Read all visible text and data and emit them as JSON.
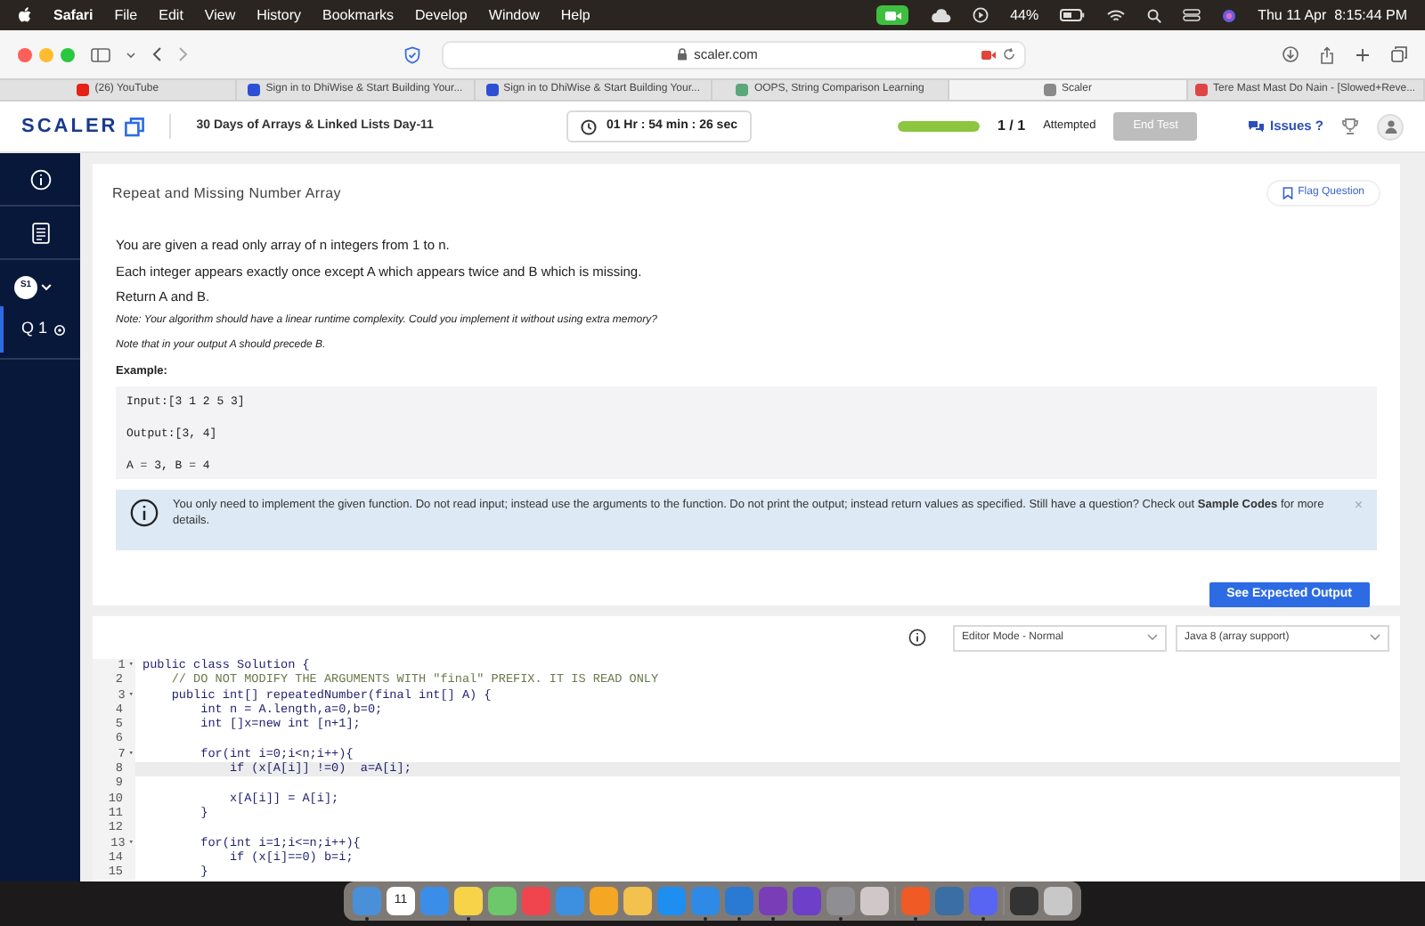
{
  "menubar": {
    "app": "Safari",
    "menus": [
      "File",
      "Edit",
      "View",
      "History",
      "Bookmarks",
      "Develop",
      "Window",
      "Help"
    ],
    "battery": "44%",
    "clock": "Thu 11 Apr  8:15:44 PM"
  },
  "browser": {
    "address": "scaler.com",
    "tabs": [
      {
        "title": "(26) YouTube",
        "selected": false,
        "color": "#e62117"
      },
      {
        "title": "Sign in to DhiWise & Start Building Your...",
        "selected": false,
        "color": "#2d4fd6"
      },
      {
        "title": "Sign in to DhiWise & Start Building Your...",
        "selected": false,
        "color": "#2d4fd6"
      },
      {
        "title": "OOPS, String Comparison Learning",
        "selected": false,
        "color": "#5aa87a"
      },
      {
        "title": "Scaler",
        "selected": true,
        "color": "#8a8a8a"
      },
      {
        "title": "Tere Mast Mast Do Nain - [Slowed+Reve...",
        "selected": false,
        "color": "#e04545"
      }
    ]
  },
  "header": {
    "logo": "SCALER",
    "title": "30 Days of Arrays & Linked Lists Day-11",
    "timer": "01 Hr : 54 min : 26 sec",
    "progress": {
      "level": 1.0
    },
    "count": "1 / 1",
    "count_label": "Attempted",
    "end_test": {
      "label": "End Test",
      "disabled": true
    },
    "issues": "Issues ?"
  },
  "sidebar": {
    "section": "S1",
    "questions": [
      {
        "label": "Q 1",
        "selected": true
      }
    ]
  },
  "problem": {
    "title": "Repeat and Missing Number Array",
    "flag": "Flag Question",
    "paragraphs": [
      "You are given a read only array of n integers from 1 to n.",
      "Each integer appears exactly once except A which appears twice and B which is missing.",
      "Return A and B."
    ],
    "notes": [
      "Note: Your algorithm should have a linear runtime complexity. Could you implement it without using extra memory?",
      "Note that in your output A should precede B."
    ],
    "example_label": "Example:",
    "example_lines": [
      "Input:[3 1 2 5 3]",
      "Output:[3, 4]",
      "A = 3, B = 4"
    ],
    "info": "You only need to implement the given function. Do not read input; instead use the arguments to the function. Do not print the output; instead return values as specified. Still have a question? Check out **Sample Codes** for more details.",
    "close": "×",
    "button": "See Expected Output"
  },
  "editor": {
    "mode": "Editor Mode - Normal",
    "language": "Java 8 (array support)",
    "lines": [
      {
        "number": "1",
        "fold": "▾",
        "highlighted": false,
        "kind": "code",
        "text": "public class Solution {"
      },
      {
        "number": "2",
        "highlighted": false,
        "kind": "comment",
        "text": "    // DO NOT MODIFY THE ARGUMENTS WITH \"final\" PREFIX. IT IS READ ONLY"
      },
      {
        "number": "3",
        "fold": "▾",
        "highlighted": false,
        "kind": "code",
        "text": "    public int[] repeatedNumber(final int[] A) {"
      },
      {
        "number": "4",
        "highlighted": false,
        "kind": "code",
        "text": "        int n = A.length,a=0,b=0;"
      },
      {
        "number": "5",
        "highlighted": false,
        "kind": "code",
        "text": "        int []x=new int [n+1];"
      },
      {
        "number": "6",
        "highlighted": false
      },
      {
        "number": "7",
        "fold": "▾",
        "highlighted": false,
        "kind": "code",
        "text": "        for(int i=0;i<n;i++){"
      },
      {
        "number": "8",
        "highlighted": true,
        "kind": "code",
        "text": "            if (x[A[i]] !=0)  a=A[i];"
      },
      {
        "number": "9",
        "highlighted": false
      },
      {
        "number": "10",
        "highlighted": false,
        "kind": "code",
        "text": "            x[A[i]] = A[i];"
      },
      {
        "number": "11",
        "highlighted": false,
        "kind": "code",
        "text": "        }"
      },
      {
        "number": "12",
        "highlighted": false
      },
      {
        "number": "13",
        "fold": "▾",
        "highlighted": false,
        "kind": "code",
        "text": "        for(int i=1;i<=n;i++){"
      },
      {
        "number": "14",
        "highlighted": false,
        "kind": "code",
        "text": "            if (x[i]==0) b=i;"
      },
      {
        "number": "15",
        "highlighted": false,
        "kind": "code",
        "text": "        }"
      }
    ]
  },
  "dock": {
    "apps": [
      {
        "kind": "app",
        "color": "#4a90d9",
        "running": true
      },
      {
        "kind": "calendar",
        "day": "11",
        "running": false
      },
      {
        "kind": "app",
        "color": "#3b8ee8",
        "running": false
      },
      {
        "kind": "app",
        "color": "#f7d34a",
        "running": true
      },
      {
        "kind": "app",
        "color": "#6cc86a",
        "running": false
      },
      {
        "kind": "app",
        "color": "#f0454f",
        "running": false
      },
      {
        "kind": "app",
        "color": "#3d8fe0",
        "running": false
      },
      {
        "kind": "app",
        "color": "#f5a623",
        "running": false
      },
      {
        "kind": "app",
        "color": "#f2c14e",
        "running": false
      },
      {
        "kind": "app",
        "color": "#1e8ef0",
        "running": false
      },
      {
        "kind": "app",
        "color": "#2e8ae6",
        "running": true
      },
      {
        "kind": "app",
        "color": "#2a7ad3",
        "running": true
      },
      {
        "kind": "app",
        "color": "#7a3db8",
        "running": true
      },
      {
        "kind": "app",
        "color": "#6e40c9",
        "running": false
      },
      {
        "kind": "app",
        "color": "#8e8e93",
        "running": true
      },
      {
        "kind": "app",
        "color": "#d0c8c8",
        "running": false
      },
      {
        "kind": "separator"
      },
      {
        "kind": "app",
        "color": "#f05a24",
        "running": true
      },
      {
        "kind": "app",
        "color": "#3a6ea5",
        "running": false
      },
      {
        "kind": "app",
        "color": "#5865f2",
        "running": true
      },
      {
        "kind": "separator"
      },
      {
        "kind": "app",
        "color": "#333333",
        "running": false
      },
      {
        "kind": "app",
        "color": "#c8c8c8",
        "running": false
      }
    ]
  }
}
